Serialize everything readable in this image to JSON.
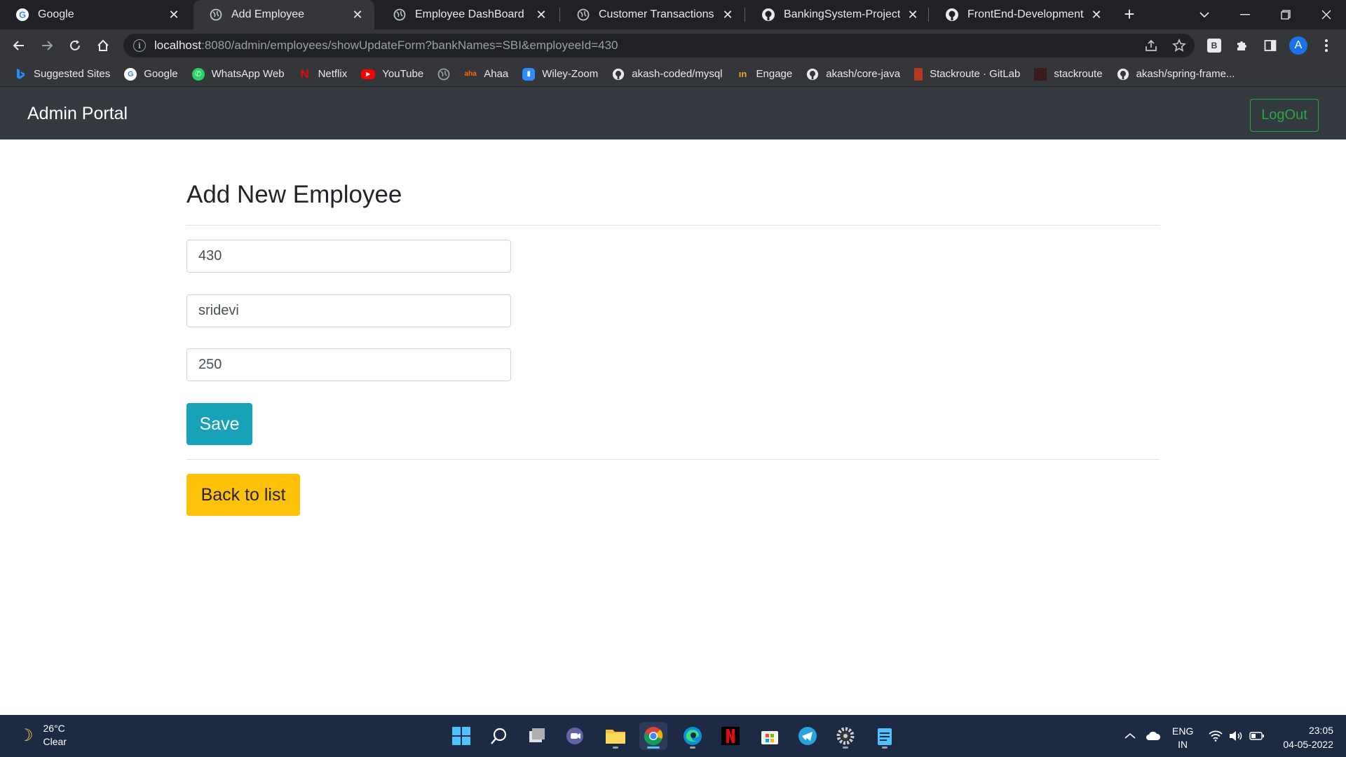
{
  "browser": {
    "tabs": [
      {
        "title": "Google",
        "active": false
      },
      {
        "title": "Add Employee",
        "active": true
      },
      {
        "title": "Employee DashBoard",
        "active": false
      },
      {
        "title": "Customer Transactions",
        "active": false
      },
      {
        "title": "BankingSystem-Project/list",
        "active": false
      },
      {
        "title": "FrontEnd-Development/bo",
        "active": false
      }
    ],
    "url_host": "localhost",
    "url_rest": ":8080/admin/employees/showUpdateForm?bankNames=SBI&employeeId=430",
    "profile_initial": "A",
    "extension_label": "B"
  },
  "bookmarks": [
    {
      "label": "Suggested Sites",
      "icon": "bing-icon"
    },
    {
      "label": "Google",
      "icon": "google-icon"
    },
    {
      "label": "WhatsApp Web",
      "icon": "whatsapp-icon"
    },
    {
      "label": "Netflix",
      "icon": "netflix-icon"
    },
    {
      "label": "YouTube",
      "icon": "youtube-icon"
    },
    {
      "label": "",
      "icon": "globe-icon"
    },
    {
      "label": "Ahaa",
      "icon": "aha-icon"
    },
    {
      "label": "Wiley-Zoom",
      "icon": "zoom-icon"
    },
    {
      "label": "akash-coded/mysql",
      "icon": "github-icon"
    },
    {
      "label": "Engage",
      "icon": "engage-icon"
    },
    {
      "label": "akash/core-java",
      "icon": "github-icon"
    },
    {
      "label": "Stackroute · GitLab",
      "icon": "gitlab-icon"
    },
    {
      "label": "stackroute",
      "icon": "stackroute-icon"
    },
    {
      "label": "akash/spring-frame...",
      "icon": "github-icon"
    }
  ],
  "app": {
    "brand": "Admin Portal",
    "logout_label": "LogOut",
    "page_title": "Add New Employee",
    "fields": {
      "employee_id": "430",
      "employee_name": "sridevi",
      "amount": "250"
    },
    "save_label": "Save",
    "back_label": "Back to list"
  },
  "colors": {
    "navbar": "#343a40",
    "logout_border": "#28a745",
    "save_button": "#17a2b8",
    "back_button": "#ffc107"
  },
  "taskbar": {
    "weather_temp": "26°C",
    "weather_cond": "Clear",
    "lang_top": "ENG",
    "lang_bottom": "IN",
    "time": "23:05",
    "date": "04-05-2022"
  }
}
